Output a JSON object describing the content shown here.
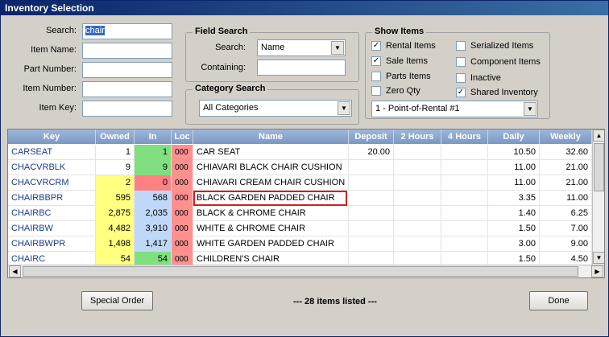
{
  "window": {
    "title": "Inventory Selection"
  },
  "search": {
    "search_label": "Search:",
    "search_value": "chair",
    "item_name_label": "Item Name:",
    "part_number_label": "Part Number:",
    "item_number_label": "Item Number:",
    "item_key_label": "Item Key:"
  },
  "field_search": {
    "title": "Field Search",
    "search_label": "Search:",
    "search_value": "Name",
    "containing_label": "Containing:"
  },
  "category_search": {
    "title": "Category Search",
    "value": "All Categories"
  },
  "show_items": {
    "title": "Show Items",
    "options": [
      {
        "label": "Rental Items",
        "checked": true
      },
      {
        "label": "Serialized Items",
        "checked": false
      },
      {
        "label": "Sale Items",
        "checked": true
      },
      {
        "label": "Component Items",
        "checked": false
      },
      {
        "label": "Parts Items",
        "checked": false
      },
      {
        "label": "Inactive",
        "checked": false
      },
      {
        "label": "Zero Qty",
        "checked": false
      },
      {
        "label": "Shared Inventory",
        "checked": true
      }
    ],
    "store_value": "1 - Point-of-Rental #1"
  },
  "grid": {
    "columns": [
      "Key",
      "Owned",
      "In",
      "Loc",
      "Name",
      "Deposit",
      "2 Hours",
      "4 Hours",
      "Daily",
      "Weekly"
    ],
    "rows": [
      {
        "key": "CARSEAT",
        "owned": "1",
        "in": "1",
        "loc": "000",
        "name": "CAR SEAT",
        "deposit": "20.00",
        "h2": "",
        "h4": "",
        "daily": "10.50",
        "weekly": "32.60"
      },
      {
        "key": "CHACVRBLK",
        "owned": "9",
        "in": "9",
        "loc": "000",
        "name": "CHIAVARI BLACK CHAIR CUSHION",
        "deposit": "",
        "h2": "",
        "h4": "",
        "daily": "11.00",
        "weekly": "21.00"
      },
      {
        "key": "CHACVRCRM",
        "owned": "2",
        "in": "0",
        "loc": "000",
        "name": "CHIAVARI CREAM CHAIR CUSHION",
        "deposit": "",
        "h2": "",
        "h4": "",
        "daily": "11.00",
        "weekly": "21.00"
      },
      {
        "key": "CHAIRBBPR",
        "owned": "595",
        "in": "568",
        "loc": "000",
        "name": "BLACK GARDEN PADDED CHAIR",
        "deposit": "",
        "h2": "",
        "h4": "",
        "daily": "3.35",
        "weekly": "11.00"
      },
      {
        "key": "CHAIRBC",
        "owned": "2,875",
        "in": "2,035",
        "loc": "000",
        "name": "BLACK & CHROME CHAIR",
        "deposit": "",
        "h2": "",
        "h4": "",
        "daily": "1.40",
        "weekly": "6.25"
      },
      {
        "key": "CHAIRBW",
        "owned": "4,482",
        "in": "3,910",
        "loc": "000",
        "name": "WHITE & CHROME CHAIR",
        "deposit": "",
        "h2": "",
        "h4": "",
        "daily": "1.50",
        "weekly": "7.00"
      },
      {
        "key": "CHAIRBWPR",
        "owned": "1,498",
        "in": "1,417",
        "loc": "000",
        "name": "WHITE GARDEN PADDED CHAIR",
        "deposit": "",
        "h2": "",
        "h4": "",
        "daily": "3.00",
        "weekly": "9.00"
      },
      {
        "key": "CHAIRC",
        "owned": "54",
        "in": "54",
        "loc": "000",
        "name": "CHILDREN'S CHAIR",
        "deposit": "",
        "h2": "",
        "h4": "",
        "daily": "1.50",
        "weekly": "4.50"
      }
    ]
  },
  "footer": {
    "special_order_label": "Special Order",
    "status": "--- 28 items listed ---",
    "done_label": "Done"
  },
  "colors": {
    "owned_yellow": "#ffff80",
    "in_green": "#80e080",
    "in_red": "#ff8080",
    "in_blue": "#c0d8f8",
    "loc_pink": "#ff9090",
    "highlight_border": "#d02020"
  }
}
